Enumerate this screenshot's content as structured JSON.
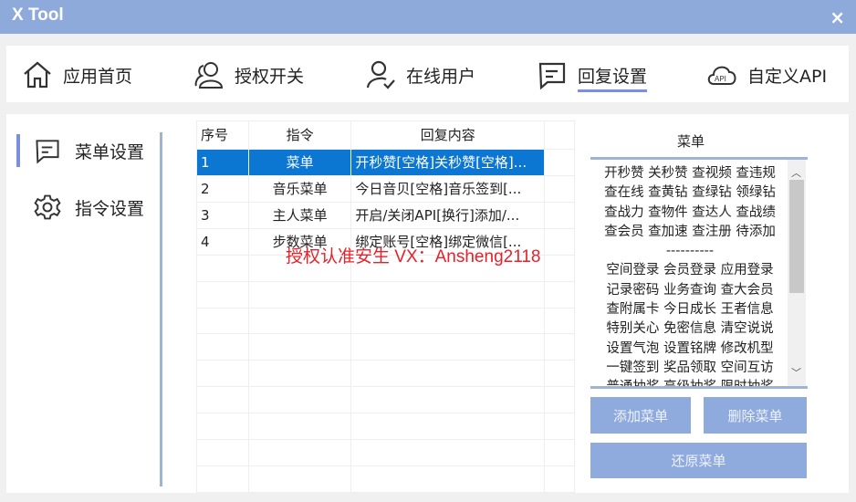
{
  "window": {
    "title": "X Tool",
    "close": "×"
  },
  "nav": [
    {
      "label": "应用首页",
      "icon": "home-icon"
    },
    {
      "label": "授权开关",
      "icon": "users-icon"
    },
    {
      "label": "在线用户",
      "icon": "user-check-icon"
    },
    {
      "label": "回复设置",
      "icon": "message-icon",
      "active": true
    },
    {
      "label": "自定义API",
      "icon": "api-cloud-icon"
    }
  ],
  "sidebar": [
    {
      "label": "菜单设置",
      "icon": "message-icon",
      "active": true
    },
    {
      "label": "指令设置",
      "icon": "gear-icon"
    }
  ],
  "table": {
    "headers": [
      "序号",
      "指令",
      "回复内容"
    ],
    "rows": [
      [
        "1",
        "菜单",
        "开秒赞[空格]关秒赞[空格]..."
      ],
      [
        "2",
        "音乐菜单",
        "今日音贝[空格]音乐签到[..."
      ],
      [
        "3",
        "主人菜单",
        "开启/关闭API[换行]添加/..."
      ],
      [
        "4",
        "步数菜单",
        "绑定账号[空格]绑定微信[..."
      ]
    ],
    "selected_row": 0
  },
  "menu_panel": {
    "label": "菜单",
    "lines": [
      "开秒赞 关秒赞 查视频 查违规",
      "查在线 查黄钻 查绿钻 领绿钻",
      "查战力 查物件 查达人 查战绩",
      "查会员 查加速 查注册 待添加",
      "----------",
      "空间登录 会员登录 应用登录",
      "记录密码 业务查询 查大会员",
      "查附属卡 今日成长 王者信息",
      "特别关心 免密信息 清空说说",
      "设置气泡 设置铭牌 修改机型",
      "一键签到 奖品领取 空间互访",
      "普通抽奖 高级抽奖 限时抽奖"
    ]
  },
  "buttons": {
    "add": "添加菜单",
    "delete": "删除菜单",
    "restore": "还原菜单"
  },
  "watermark": "授权认准安生  VX：Ansheng2118",
  "colors": {
    "titlebar": "#8eaadb",
    "accent": "#7a90dc",
    "selection": "#0b77d3",
    "button": "#8faadc",
    "watermark": "#e8202a"
  }
}
